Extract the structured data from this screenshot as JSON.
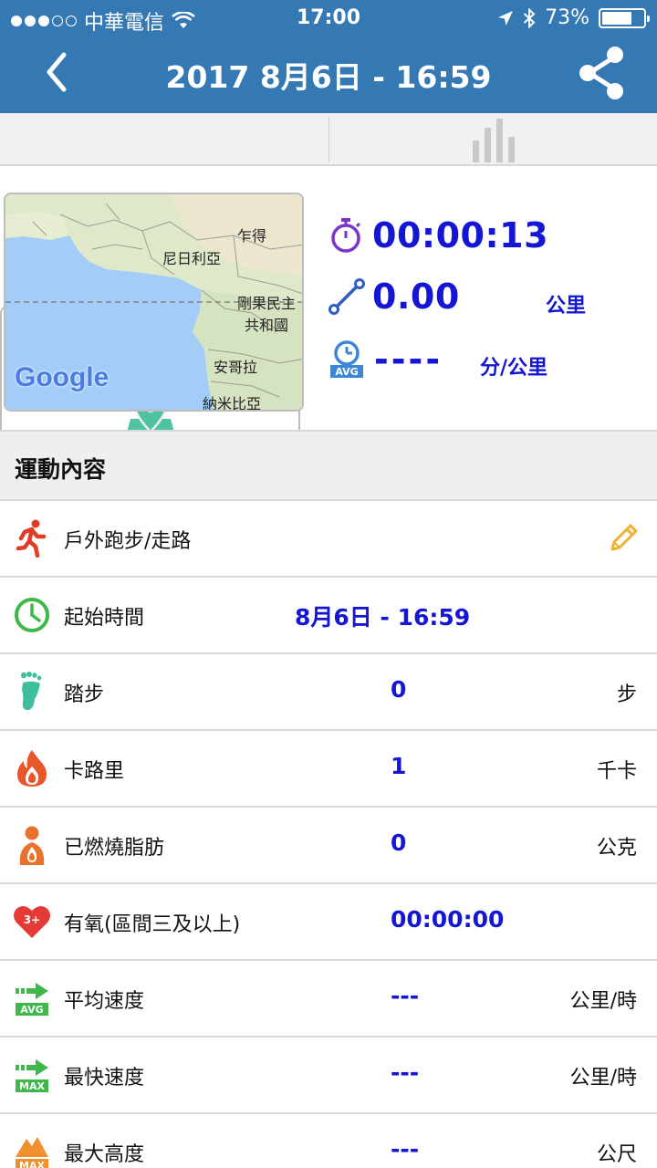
{
  "status_bar": {
    "carrier": "中華電信",
    "time": "17:00",
    "battery": "73%",
    "battery_level": 0.73
  },
  "header": {
    "title": "2017 8月6日 - 16:59"
  },
  "tabs": [
    {
      "icon": "map-pin-icon",
      "active": true
    },
    {
      "icon": "bar-chart-icon",
      "active": false
    }
  ],
  "map": {
    "labels": [
      "乍得",
      "尼日利亞",
      "剛果民主",
      "共和國",
      "安哥拉",
      "納米比亞"
    ],
    "brand": "Google"
  },
  "summary": {
    "duration": "00:00:13",
    "distance": "0.00",
    "distance_unit": "公里",
    "pace": "----",
    "pace_unit": "分/公里",
    "avg_badge": "AVG"
  },
  "section": {
    "title": "運動內容"
  },
  "rows": [
    {
      "label": "戶外跑步/走路",
      "value": "",
      "unit": ""
    },
    {
      "label": "起始時間",
      "value": "8月6日 - 16:59",
      "unit": ""
    },
    {
      "label": "踏步",
      "value": "0",
      "unit": "步"
    },
    {
      "label": "卡路里",
      "value": "1",
      "unit": "千卡"
    },
    {
      "label": "已燃燒脂肪",
      "value": "0",
      "unit": "公克"
    },
    {
      "label": "有氧(區間三及以上)",
      "value": "00:00:00",
      "unit": ""
    },
    {
      "label": "平均速度",
      "value": "---",
      "unit": "公里/時"
    },
    {
      "label": "最快速度",
      "value": "---",
      "unit": "公里/時"
    },
    {
      "label": "最大高度",
      "value": "---",
      "unit": "公尺"
    }
  ],
  "icon_badges": {
    "heart": "3+",
    "avg": "AVG",
    "max": "MAX"
  },
  "colors": {
    "header": "#3478b4",
    "value_blue": "#1515d4",
    "tab_active": "#4fc3a1",
    "edit_pencil": "#f0b030"
  }
}
